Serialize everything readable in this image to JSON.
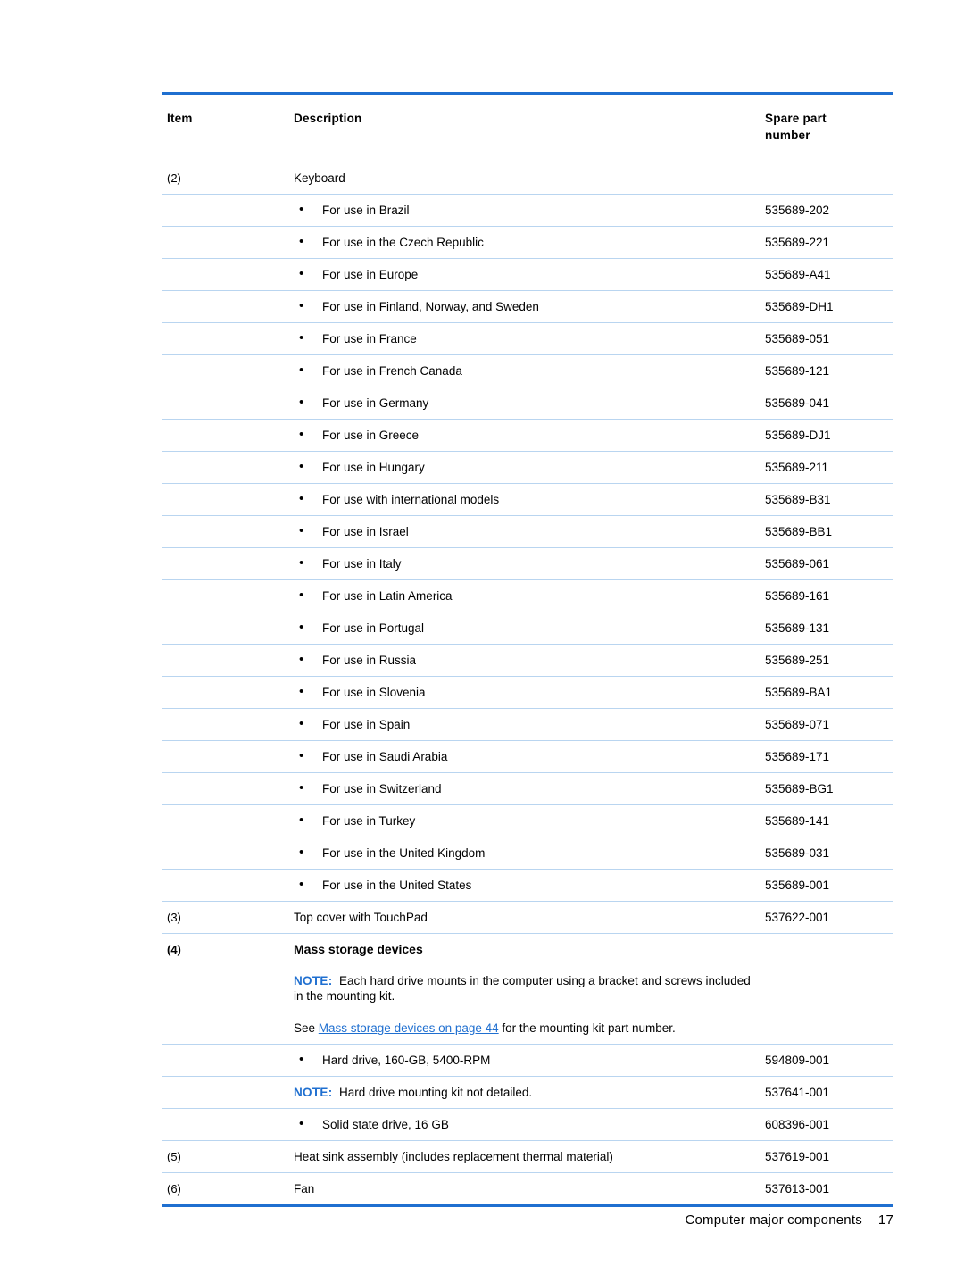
{
  "table": {
    "headers": {
      "item": "Item",
      "description": "Description",
      "spare_part": "Spare part",
      "spare_part_2": "number"
    },
    "rows": [
      {
        "item": "(2)",
        "desc": "Keyboard",
        "spare": "",
        "style": "plain"
      },
      {
        "item": "",
        "desc": "For use in Brazil",
        "spare": "535689-202",
        "style": "bullet"
      },
      {
        "item": "",
        "desc": "For use in the Czech Republic",
        "spare": "535689-221",
        "style": "bullet"
      },
      {
        "item": "",
        "desc": "For use in Europe",
        "spare": "535689-A41",
        "style": "bullet"
      },
      {
        "item": "",
        "desc": "For use in Finland, Norway, and Sweden",
        "spare": "535689-DH1",
        "style": "bullet"
      },
      {
        "item": "",
        "desc": "For use in France",
        "spare": "535689-051",
        "style": "bullet"
      },
      {
        "item": "",
        "desc": "For use in French Canada",
        "spare": "535689-121",
        "style": "bullet"
      },
      {
        "item": "",
        "desc": "For use in Germany",
        "spare": "535689-041",
        "style": "bullet"
      },
      {
        "item": "",
        "desc": "For use in Greece",
        "spare": "535689-DJ1",
        "style": "bullet"
      },
      {
        "item": "",
        "desc": "For use in Hungary",
        "spare": "535689-211",
        "style": "bullet"
      },
      {
        "item": "",
        "desc": "For use with international models",
        "spare": "535689-B31",
        "style": "bullet"
      },
      {
        "item": "",
        "desc": "For use in Israel",
        "spare": "535689-BB1",
        "style": "bullet"
      },
      {
        "item": "",
        "desc": "For use in Italy",
        "spare": "535689-061",
        "style": "bullet"
      },
      {
        "item": "",
        "desc": "For use in Latin America",
        "spare": "535689-161",
        "style": "bullet"
      },
      {
        "item": "",
        "desc": "For use in Portugal",
        "spare": "535689-131",
        "style": "bullet"
      },
      {
        "item": "",
        "desc": "For use in Russia",
        "spare": "535689-251",
        "style": "bullet"
      },
      {
        "item": "",
        "desc": "For use in Slovenia",
        "spare": "535689-BA1",
        "style": "bullet"
      },
      {
        "item": "",
        "desc": "For use in Spain",
        "spare": "535689-071",
        "style": "bullet"
      },
      {
        "item": "",
        "desc": "For use in Saudi Arabia",
        "spare": "535689-171",
        "style": "bullet"
      },
      {
        "item": "",
        "desc": "For use in Switzerland",
        "spare": "535689-BG1",
        "style": "bullet"
      },
      {
        "item": "",
        "desc": "For use in Turkey",
        "spare": "535689-141",
        "style": "bullet"
      },
      {
        "item": "",
        "desc": "For use in the United Kingdom",
        "spare": "535689-031",
        "style": "bullet"
      },
      {
        "item": "",
        "desc": "For use in the United States",
        "spare": "535689-001",
        "style": "bullet"
      },
      {
        "item": "(3)",
        "desc": "Top cover with TouchPad",
        "spare": "537622-001",
        "style": "plain"
      },
      {
        "item": "(4)",
        "desc": "Mass storage devices",
        "spare": "",
        "style": "bold"
      },
      {
        "item": "",
        "desc": "Each hard drive mounts in the computer using a bracket and screws included in the mounting kit.",
        "note": "NOTE:",
        "spare": "",
        "style": "note"
      },
      {
        "item": "",
        "desc": "Hard drive, 160-GB, 5400-RPM",
        "spare": "594809-001",
        "style": "bullet"
      },
      {
        "item": "",
        "desc": "Hard drive mounting kit not detailed.",
        "note": "NOTE:",
        "spare": "537641-001",
        "style": "note"
      },
      {
        "item": "",
        "desc": "Solid state drive, 16 GB",
        "spare": "608396-001",
        "style": "bullet"
      },
      {
        "item": "(5)",
        "desc": "Heat sink assembly (includes replacement thermal material)",
        "spare": "537619-001",
        "style": "plain"
      },
      {
        "item": "(6)",
        "desc": "Fan",
        "spare": "537613-001",
        "style": "plain"
      }
    ],
    "see_line": {
      "prefix": "See ",
      "link": "Mass storage devices on page 44",
      "suffix": " for the mounting kit part number."
    }
  },
  "footer": {
    "text": "Computer major components",
    "page_number": "17"
  },
  "colors": {
    "accent": "#1f6fd0",
    "rule": "#b9d5f0"
  }
}
